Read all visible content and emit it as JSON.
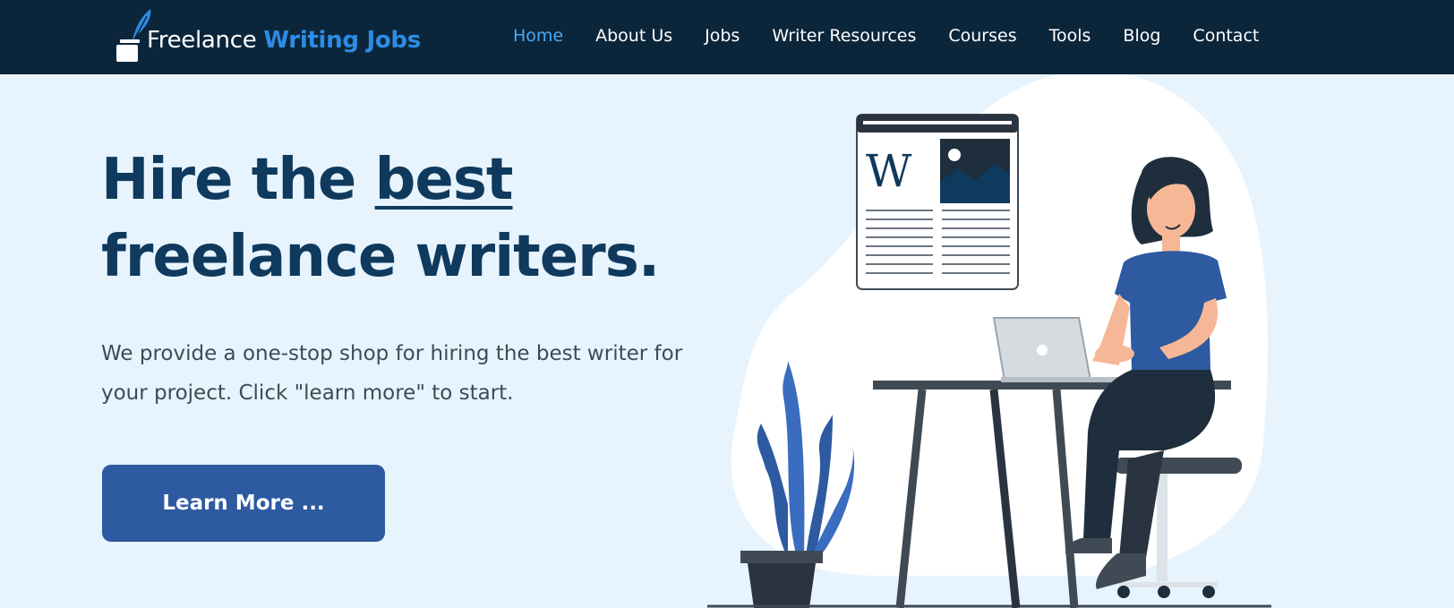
{
  "header": {
    "logo": {
      "word1": "Freelance",
      "word2": "Writing Jobs"
    },
    "nav": [
      {
        "label": "Home",
        "active": true
      },
      {
        "label": "About Us",
        "active": false
      },
      {
        "label": "Jobs",
        "active": false
      },
      {
        "label": "Writer Resources",
        "active": false
      },
      {
        "label": "Courses",
        "active": false
      },
      {
        "label": "Tools",
        "active": false
      },
      {
        "label": "Blog",
        "active": false
      },
      {
        "label": "Contact",
        "active": false
      }
    ]
  },
  "hero": {
    "title_part1": "Hire the ",
    "title_best": "best",
    "title_part2": "freelance writers.",
    "description": "We provide a one-stop shop for hiring the best writer for your project. Click \"learn more\" to start.",
    "cta_label": "Learn More ..."
  },
  "illustration": {
    "article_letter": "W"
  },
  "colors": {
    "header_bg": "#0b263b",
    "page_bg": "#e7f4fd",
    "accent": "#2d8ce5",
    "active_nav": "#48a8f1",
    "title": "#0f3a5e",
    "button": "#2d5aa0"
  }
}
